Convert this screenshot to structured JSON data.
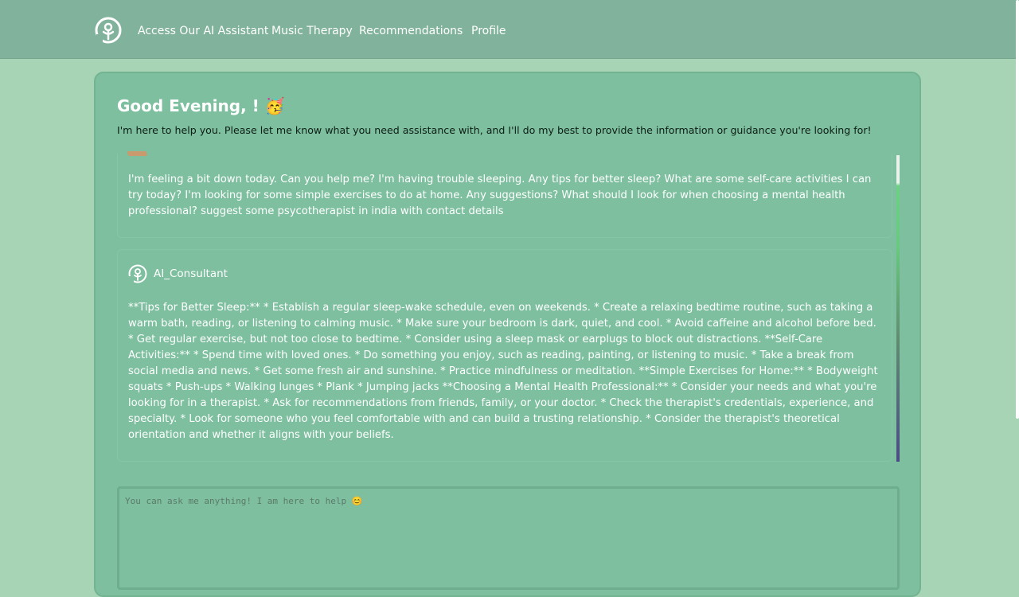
{
  "nav": {
    "links": [
      "Access Our AI Assistant",
      "Music Therapy",
      "Recommendations",
      "Profile"
    ],
    "logo_icon": "mind-head-icon"
  },
  "header": {
    "greeting": "Good Evening, ! 🥳",
    "subtitle": "I'm here to help you. Please let me know what you need assistance with, and I'll do my best to provide the information or guidance you're looking for!"
  },
  "messages": {
    "user_text": "I'm feeling a bit down today. Can you help me? I'm having trouble sleeping. Any tips for better sleep? What are some self-care activities I can try today? I'm looking for some simple exercises to do at home. Any suggestions? What should I look for when choosing a mental health professional? suggest some psycotherapist in india with contact details",
    "ai_name": "AI_Consultant",
    "ai_text": "**Tips for Better Sleep:** * Establish a regular sleep-wake schedule, even on weekends. * Create a relaxing bedtime routine, such as taking a warm bath, reading, or listening to calming music. * Make sure your bedroom is dark, quiet, and cool. * Avoid caffeine and alcohol before bed. * Get regular exercise, but not too close to bedtime. * Consider using a sleep mask or earplugs to block out distractions. **Self-Care Activities:** * Spend time with loved ones. * Do something you enjoy, such as reading, painting, or listening to music. * Take a break from social media and news. * Get some fresh air and sunshine. * Practice mindfulness or meditation. **Simple Exercises for Home:** * Bodyweight squats * Push-ups * Walking lunges * Plank * Jumping jacks **Choosing a Mental Health Professional:** * Consider your needs and what you're looking for in a therapist. * Ask for recommendations from friends, family, or your doctor. * Check the therapist's credentials, experience, and specialty. * Look for someone who you feel comfortable with and can build a trusting relationship. * Consider the therapist's theoretical orientation and whether it aligns with your beliefs."
  },
  "input": {
    "placeholder": "You can ask me anything! I am here to help 😊"
  },
  "colors": {
    "navbar": "#81b29b",
    "background": "#a6d4b5",
    "card": "#7dbf9e"
  }
}
